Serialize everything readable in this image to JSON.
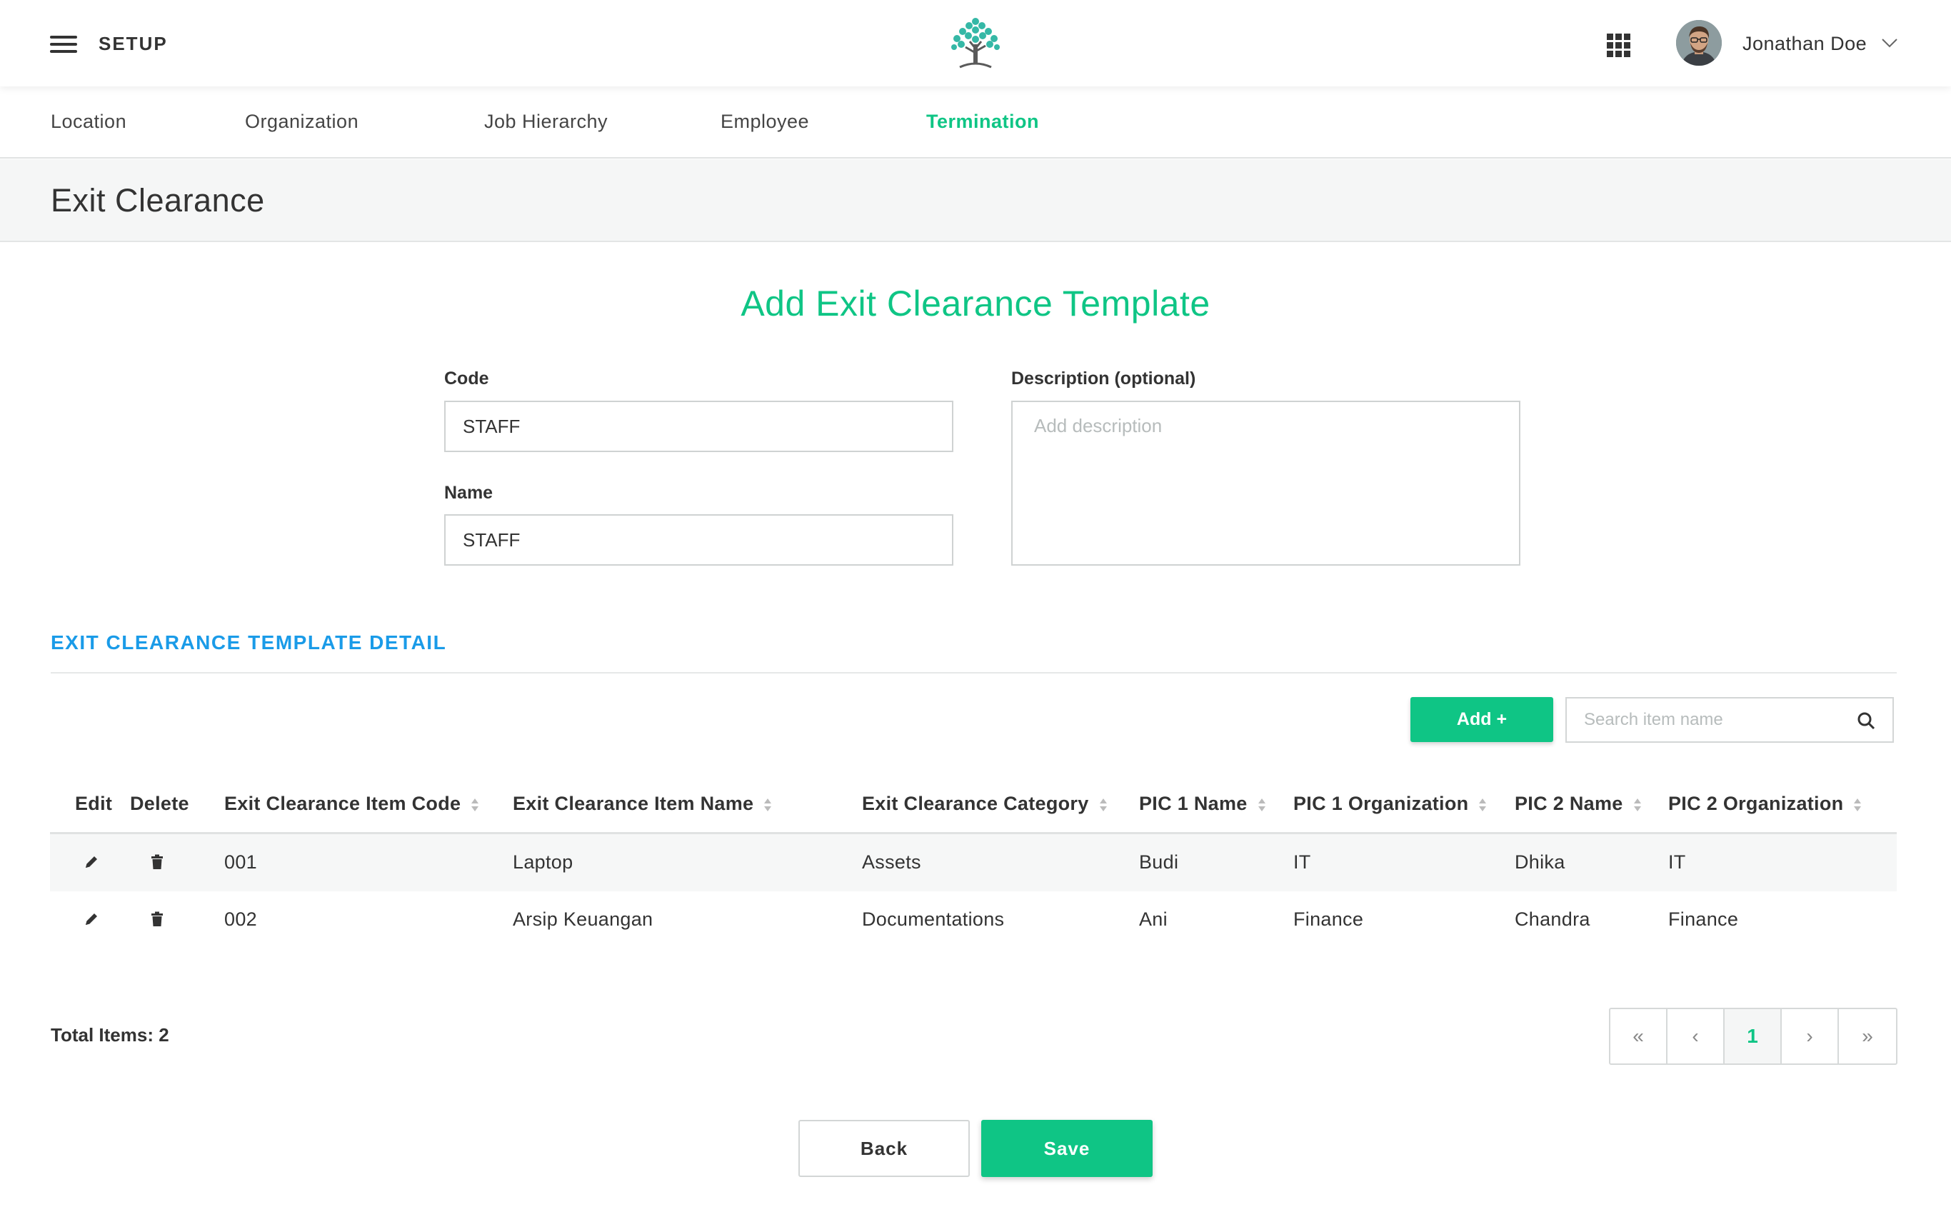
{
  "header": {
    "section_label": "SETUP",
    "user_name": "Jonathan Doe",
    "icons": [
      "menu-icon",
      "tree-logo",
      "apps-grid-icon",
      "avatar",
      "chevron-down-icon"
    ]
  },
  "subnav": {
    "tabs": [
      {
        "label": "Location",
        "active": false
      },
      {
        "label": "Organization",
        "active": false
      },
      {
        "label": "Job Hierarchy",
        "active": false
      },
      {
        "label": "Employee",
        "active": false
      },
      {
        "label": "Termination",
        "active": true
      }
    ]
  },
  "page": {
    "title": "Exit Clearance"
  },
  "form": {
    "title": "Add Exit Clearance Template",
    "code_label": "Code",
    "code_value": "STAFF",
    "name_label": "Name",
    "name_value": "STAFF",
    "description_label": "Description (optional)",
    "description_placeholder": "Add description",
    "description_value": ""
  },
  "detail": {
    "section_title": "EXIT CLEARANCE TEMPLATE DETAIL",
    "add_label": "Add +",
    "search_placeholder": "Search item name",
    "columns": [
      "Edit",
      "Delete",
      "Exit Clearance Item Code",
      "Exit Clearance Item Name",
      "Exit Clearance Category",
      "PIC 1 Name",
      "PIC 1 Organization",
      "PIC 2 Name",
      "PIC 2 Organization"
    ],
    "rows": [
      {
        "code": "001",
        "name": "Laptop",
        "category": "Assets",
        "pic1_name": "Budi",
        "pic1_org": "IT",
        "pic2_name": "Dhika",
        "pic2_org": "IT"
      },
      {
        "code": "002",
        "name": "Arsip Keuangan",
        "category": "Documentations",
        "pic1_name": "Ani",
        "pic1_org": "Finance",
        "pic2_name": "Chandra",
        "pic2_org": "Finance"
      }
    ],
    "total_items": "Total Items: 2"
  },
  "pagination": {
    "first": "«",
    "prev": "‹",
    "current_page": "1",
    "next": "›",
    "last": "»"
  },
  "footer": {
    "back_label": "Back",
    "save_label": "Save"
  },
  "colors": {
    "accent_green": "#0fc585",
    "section_blue": "#1a9be8",
    "title_bar_bg": "#f5f6f6"
  }
}
